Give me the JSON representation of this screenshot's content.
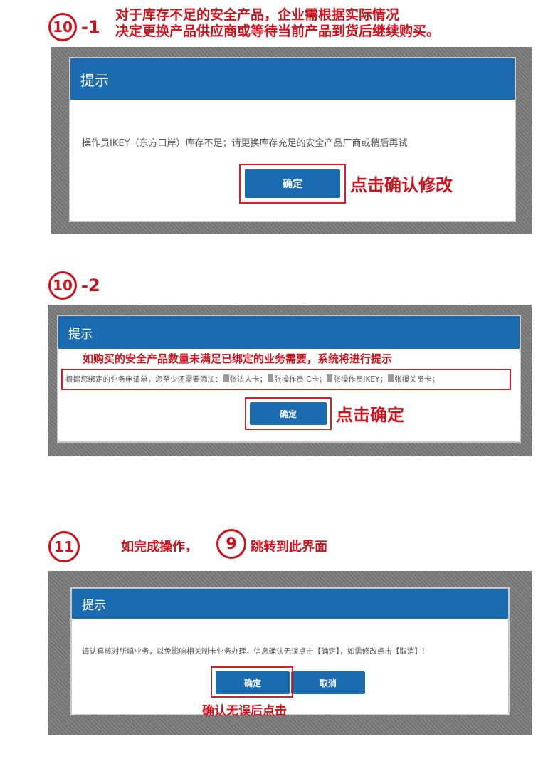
{
  "section1": {
    "step_badge": "10",
    "step_suffix": "-1",
    "instruction_line1": "对于库存不足的安全产品，企业需根据实际情况",
    "instruction_line2": "决定更换产品供应商或等待当前产品到货后继续购买。",
    "dialog": {
      "title": "提示",
      "message": "操作员IKEY（东方口岸）库存不足；请更换库存充足的安全产品厂商或稍后再试",
      "confirm_label": "确定"
    },
    "callout": "点击确认修改"
  },
  "section2": {
    "step_badge": "10",
    "step_suffix": "-2",
    "dialog": {
      "title": "提示",
      "notice": "如购买的安全产品数量未满足已绑定的业务需要，系统将进行提示",
      "message_parts": [
        "根据您绑定的业务申请单，您至少还需要添加：",
        "张法人卡；",
        "张操作员IC卡；",
        "张操作员IKEY；",
        "张报关员卡；"
      ],
      "confirm_label": "确定"
    },
    "callout": "点击确定"
  },
  "section3": {
    "step_badge": "11",
    "text_before": "如完成操作，",
    "ref_badge": "9",
    "text_after": "跳转到此界面",
    "dialog": {
      "title": "提示",
      "message": "请认真核对所填业务，以免影响相关制卡业务办理。信息确认无误点击【确定】，如需修改点击【取消】!",
      "confirm_label": "确定",
      "cancel_label": "取消"
    },
    "callout": "确认无误后点击"
  },
  "colors": {
    "accent_red": "#d0101a",
    "dialog_blue": "#1a6bb0",
    "frame_gray": "#7a7a7a"
  }
}
